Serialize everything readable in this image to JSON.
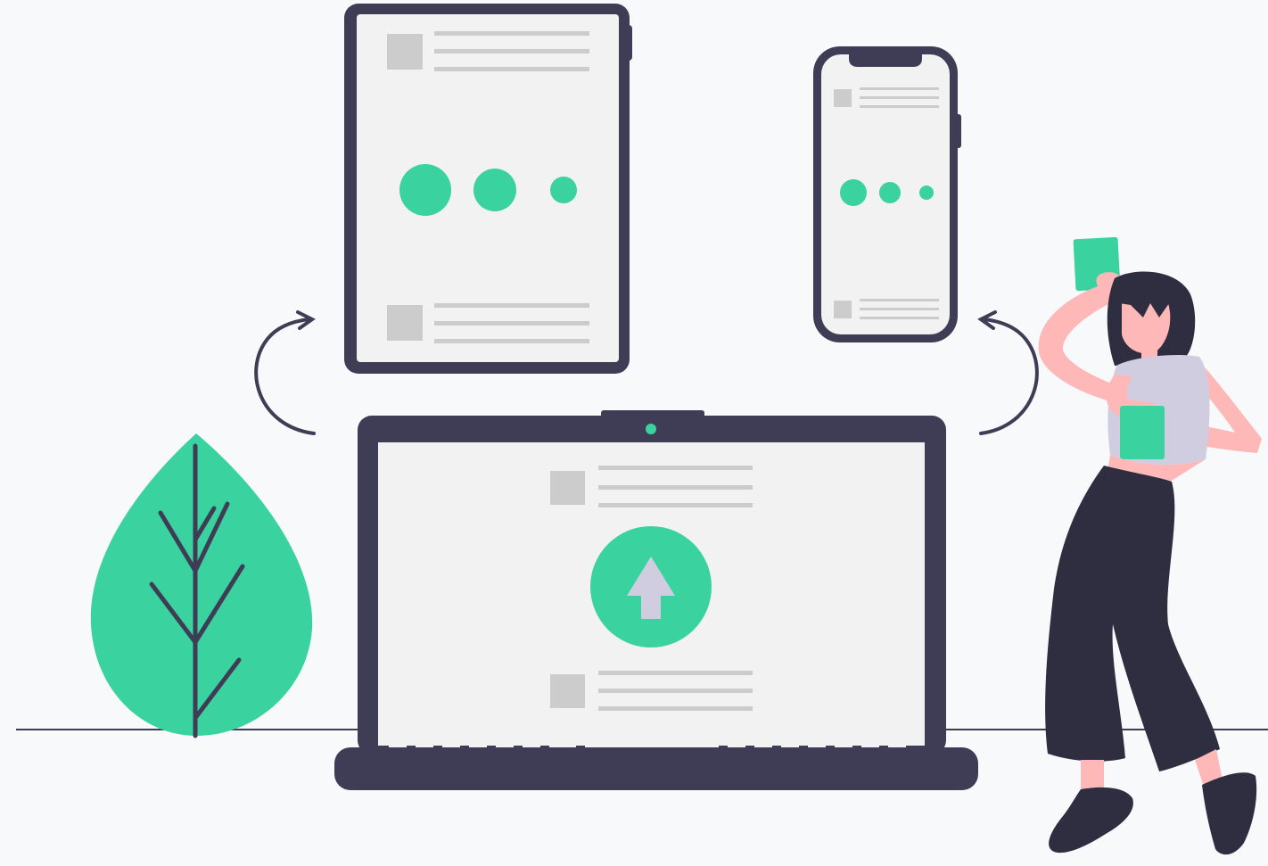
{
  "illustration": {
    "subject": "",
    "background": "#f8f9fb",
    "colors": {
      "accent": "#3ad29f",
      "dark": "#3f3d56",
      "screen": "#f2f2f2",
      "placeholder": "#cccccc",
      "skin": "#ffb8b8",
      "shirt": "#d0cde1",
      "pants": "#2f2e41",
      "arrow_up": "#d0cde1"
    },
    "icons": {
      "upload": "arrow-up-icon",
      "sync_left": "curved-arrow-icon",
      "sync_right": "curved-arrow-icon"
    },
    "devices": [
      "tablet",
      "phone",
      "laptop"
    ],
    "tablet_dots": 3,
    "phone_dots": 3
  }
}
